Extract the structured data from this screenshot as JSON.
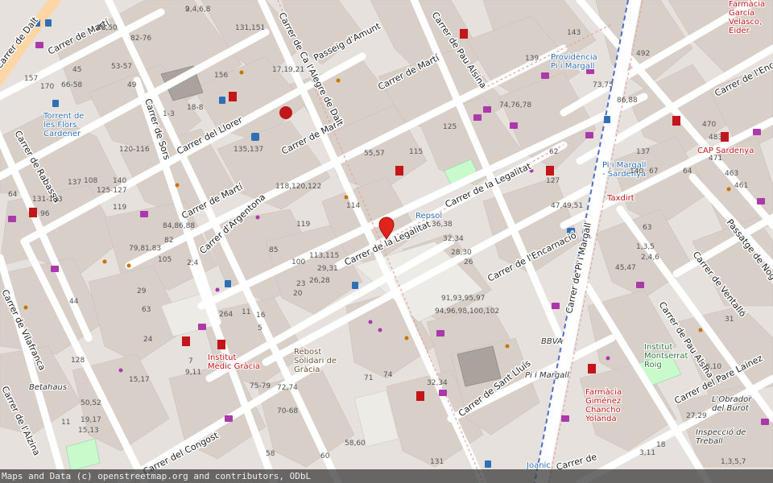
{
  "map": {
    "attribution": "Maps and Data (c) openstreetmap.org and contributors, ODbL",
    "streets": [
      "Carrer de la Legalitat",
      "Carrer de la Legalitat",
      "Carrer de Martí",
      "Carrer de Martí",
      "Carrer de Martí",
      "Carrer de Martí",
      "Carrer de Ca l'Alegre de Dalt",
      "Carrer de Pau Alsina",
      "Carrer de Pau Alsina",
      "Passeig d'Amunt",
      "Carrer de Sors",
      "Carrer del Llorer",
      "Carrer de Rabassa",
      "Carrer d'Argentona",
      "Carrer de l'Encarnació",
      "Carrer de Pi i Margall",
      "Carrer de Sant Lluís",
      "Carrer del Congost",
      "Carrer de l'Alzina",
      "Carrer de Vilafranca",
      "Carrer del Pare Lainez",
      "Carrer de Ventalló",
      "Passatge de Noguera",
      "Carrer de l'Encarnació",
      "Carrer de Dalt",
      "Carrer de"
    ],
    "pois": {
      "torrent": "Torrent de les Flors Cardener",
      "providencia": "Providència Pi i Margall",
      "farmacia_garcia": "Farmàcia García Velasco, Eider",
      "cap_sardenya": "CAP Sardenya",
      "pi_margall_sardenya": "Pi i Margall - Sardenya",
      "taxdirt": "Taxdirt",
      "repsol": "Repsol",
      "institut_medic": "Institut Mèdic Gràcia",
      "rebost": "Rebost Solidari de Gràcia",
      "farmacia_gimenez": "Farmàcia Giménez Chancho Yolanda",
      "institut_montserrat": "Institut Montserrat Roig",
      "obrador": "L'Obrador del Burot",
      "inspeccio": "Inspecció de Treball",
      "betahaus": "Betahaus",
      "bbva": "BBVA",
      "pi_margall": "Pi i Margall",
      "joanic": "Joanic"
    },
    "numbers": [
      "2,4,6,8",
      "48,50",
      "82-76",
      "131,151",
      "17,19,21",
      "156",
      "45",
      "53-57",
      "49",
      "66-58",
      "170",
      "157",
      "18-8",
      "1-3",
      "135,137",
      "120-116",
      "55,57",
      "115",
      "125",
      "143",
      "139",
      "74,76,78",
      "73,75",
      "86,88",
      "492",
      "470",
      "483",
      "471",
      "463",
      "461",
      "137",
      "140",
      "67",
      "64",
      "62",
      "47,49,51",
      "127",
      "36,38",
      "32,34",
      "28,30",
      "26",
      "118,120,122",
      "114",
      "119",
      "113,115",
      "29,31",
      "26,28",
      "23",
      "20",
      "85",
      "100",
      "84,86,88",
      "79,81,83",
      "105",
      "2,4",
      "82",
      "140",
      "125-127",
      "108",
      "131-133",
      "96",
      "119",
      "137",
      "64",
      "91,93,95,97",
      "94,96,98,100,102",
      "1,3,5",
      "2,4,6",
      "45,47",
      "63",
      "71",
      "74",
      "32,34",
      "75-79",
      "72,74",
      "70-68",
      "58",
      "60",
      "58,60",
      "131",
      "50,52",
      "19,17",
      "15,13",
      "15,17",
      "128",
      "11",
      "44",
      "63",
      "29",
      "24",
      "31",
      "27,29",
      "18",
      "3,11",
      "8,10",
      "1,3,5,7",
      "9,11",
      "264",
      "16",
      "11",
      "5",
      "7",
      "9",
      "22"
    ],
    "marker_label": "location-marker"
  },
  "colors": {
    "background": "#e8e3df",
    "building": "#d9d0c9",
    "road": "#ffffff",
    "primary_road": "#fcd6a4",
    "pharmacy": "#c2161b",
    "transit": "#2f6fb5",
    "park": "#c8facc",
    "marker": "#e0241b",
    "shop": "#ac39ac"
  }
}
